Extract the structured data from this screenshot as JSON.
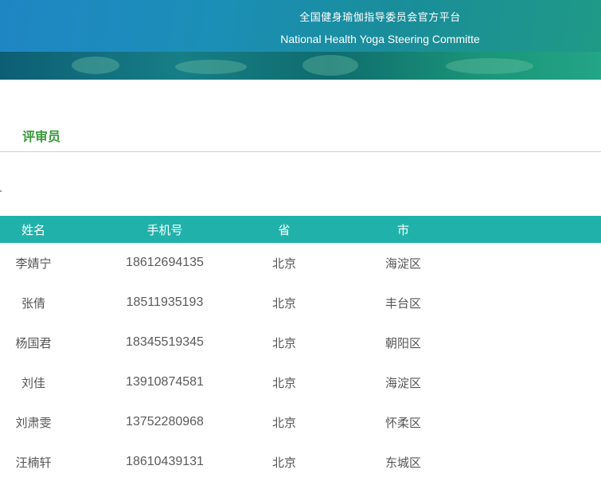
{
  "header": {
    "title_cn": "全国健身瑜伽指导委员会官方平台",
    "title_en": "National Health Yoga Steering Committe"
  },
  "section": {
    "title": "评审员"
  },
  "table": {
    "columns": [
      "姓名",
      "手机号",
      "省",
      "市"
    ],
    "rows": [
      {
        "name": "李婧宁",
        "phone": "18612694135",
        "province": "北京",
        "city": "海淀区"
      },
      {
        "name": "张倩",
        "phone": "18511935193",
        "province": "北京",
        "city": "丰台区"
      },
      {
        "name": "杨国君",
        "phone": "18345519345",
        "province": "北京",
        "city": "朝阳区"
      },
      {
        "name": "刘佳",
        "phone": "13910874581",
        "province": "北京",
        "city": "海淀区"
      },
      {
        "name": "刘肃雯",
        "phone": "13752280968",
        "province": "北京",
        "city": "怀柔区"
      },
      {
        "name": "汪楠轩",
        "phone": "18610439131",
        "province": "北京",
        "city": "东城区"
      }
    ]
  },
  "colors": {
    "header_row": "#20b2aa",
    "section_title": "#3b9a3b",
    "banner_blue": "#1f86c4",
    "banner_green": "#1f9a86"
  }
}
